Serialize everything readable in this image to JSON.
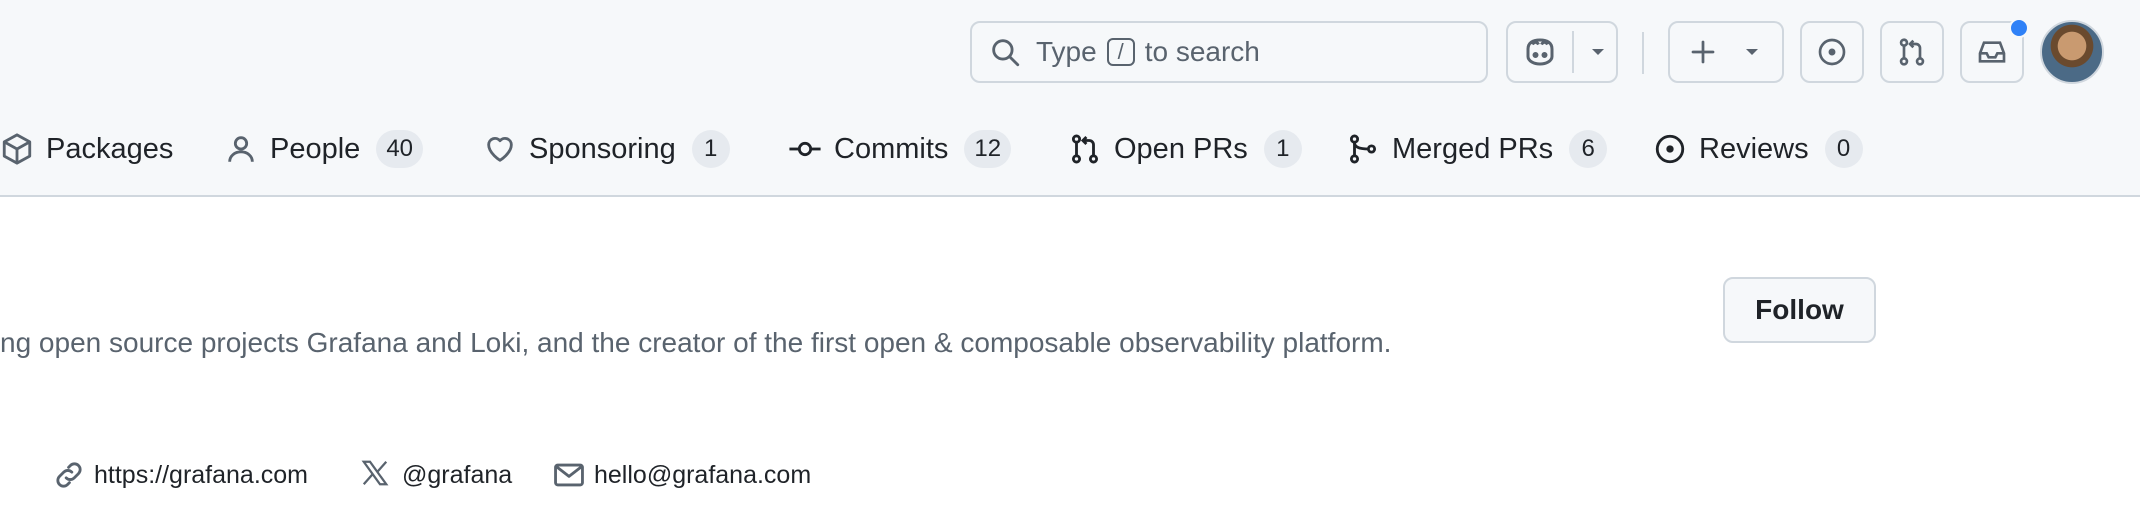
{
  "search": {
    "prefix": "Type",
    "shortcut": "/",
    "suffix": "to search"
  },
  "header_icons": {
    "copilot": "copilot-icon",
    "create": "plus-icon",
    "issues": "issue-opened-icon",
    "pull_requests": "git-pull-request-icon",
    "inbox": "inbox-icon"
  },
  "nav": {
    "items": [
      {
        "label": "Packages",
        "icon": "package-icon"
      },
      {
        "label": "People",
        "count": "40",
        "icon": "person-icon"
      },
      {
        "label": "Sponsoring",
        "count": "1",
        "icon": "heart-icon"
      },
      {
        "label": "Commits",
        "count": "12",
        "icon": "git-commit-icon"
      },
      {
        "label": "Open PRs",
        "count": "1",
        "icon": "git-pull-request-icon"
      },
      {
        "label": "Merged PRs",
        "count": "6",
        "icon": "git-merge-icon"
      },
      {
        "label": "Reviews",
        "count": "0",
        "icon": "issue-opened-icon"
      }
    ]
  },
  "profile": {
    "bio": "ng open source projects Grafana and Loki, and the creator of the first open & composable observability platform.",
    "follow_label": "Follow",
    "links": {
      "website": "https://grafana.com",
      "x": "@grafana",
      "email": "hello@grafana.com"
    }
  },
  "colors": {
    "header_bg": "#f6f8fa",
    "border": "#d0d7de",
    "muted_text": "#59636e",
    "notification": "#2f81f7"
  }
}
